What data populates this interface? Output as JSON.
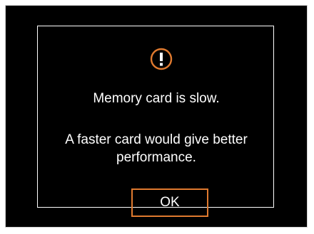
{
  "dialog": {
    "icon": "exclamation-circle-icon",
    "message_line1": "Memory card is slow.",
    "message_line2": "A faster card would give better",
    "message_line3": "performance.",
    "ok_label": "OK"
  },
  "colors": {
    "background": "#000000",
    "text": "#ffffff",
    "accent": "#e07a2f",
    "dialog_border": "#ffffff"
  }
}
